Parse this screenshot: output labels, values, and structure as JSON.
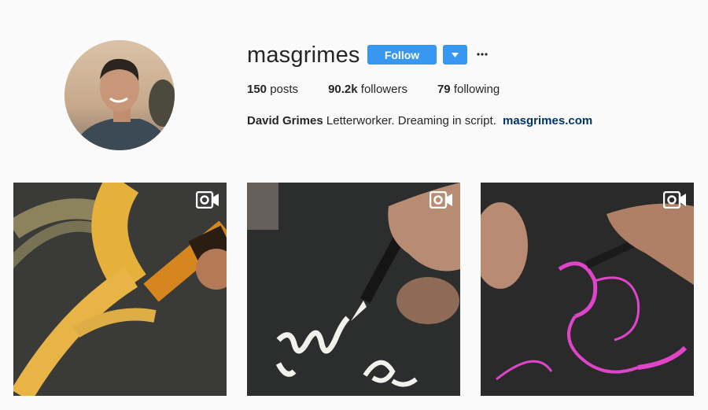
{
  "profile": {
    "username": "masgrimes",
    "follow_label": "Follow",
    "more_icon": "ellipsis-icon",
    "dropdown_icon": "caret-down-icon",
    "stats": [
      {
        "count": "150",
        "label": "posts"
      },
      {
        "count": "90.2k",
        "label": "followers"
      },
      {
        "count": "79",
        "label": "following"
      }
    ],
    "full_name": "David Grimes",
    "bio": "Letterworker. Dreaming in script.",
    "website": "masgrimes.com"
  },
  "posts": [
    {
      "type": "video",
      "icon": "video-camera-icon",
      "ink_color": "#e8b94a"
    },
    {
      "type": "video",
      "icon": "video-camera-icon",
      "ink_color": "#ffffff"
    },
    {
      "type": "video",
      "icon": "video-camera-icon",
      "ink_color": "#e044c8"
    }
  ],
  "colors": {
    "accent": "#3897f0",
    "link": "#003569",
    "background": "#fafafa"
  }
}
